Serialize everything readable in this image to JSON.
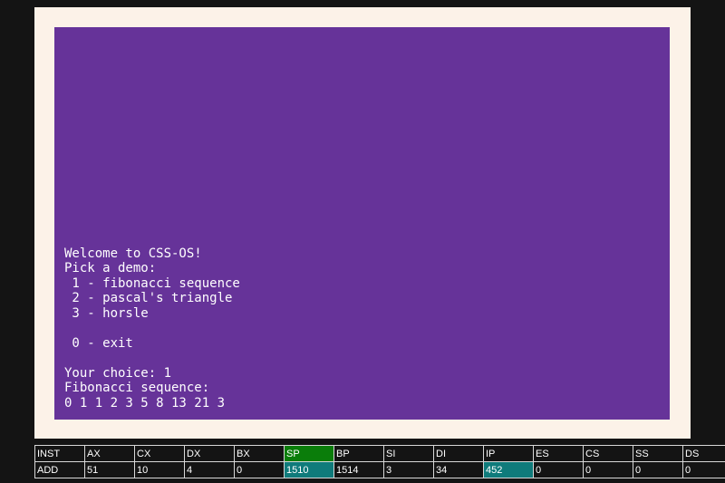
{
  "terminal": {
    "lines": [
      "Welcome to CSS-OS!",
      "Pick a demo:",
      " 1 - fibonacci sequence",
      " 2 - pascal's triangle",
      " 3 - horsle",
      "",
      " 0 - exit",
      "",
      "Your choice: 1",
      "Fibonacci sequence:",
      "0 1 1 2 3 5 8 13 21 3"
    ]
  },
  "registers": {
    "headers": [
      "INST",
      "AX",
      "CX",
      "DX",
      "BX",
      "SP",
      "BP",
      "SI",
      "DI",
      "IP",
      "ES",
      "CS",
      "SS",
      "DS"
    ],
    "values": [
      "ADD",
      "51",
      "10",
      "4",
      "0",
      "1510",
      "1514",
      "3",
      "34",
      "452",
      "0",
      "0",
      "0",
      "0"
    ]
  },
  "colors": {
    "screen_bg": "#663399",
    "frame_bg": "#fcf2e8",
    "page_bg": "#141414",
    "highlight_header": "#0a7d0a",
    "highlight_value": "#0f7b7b"
  }
}
